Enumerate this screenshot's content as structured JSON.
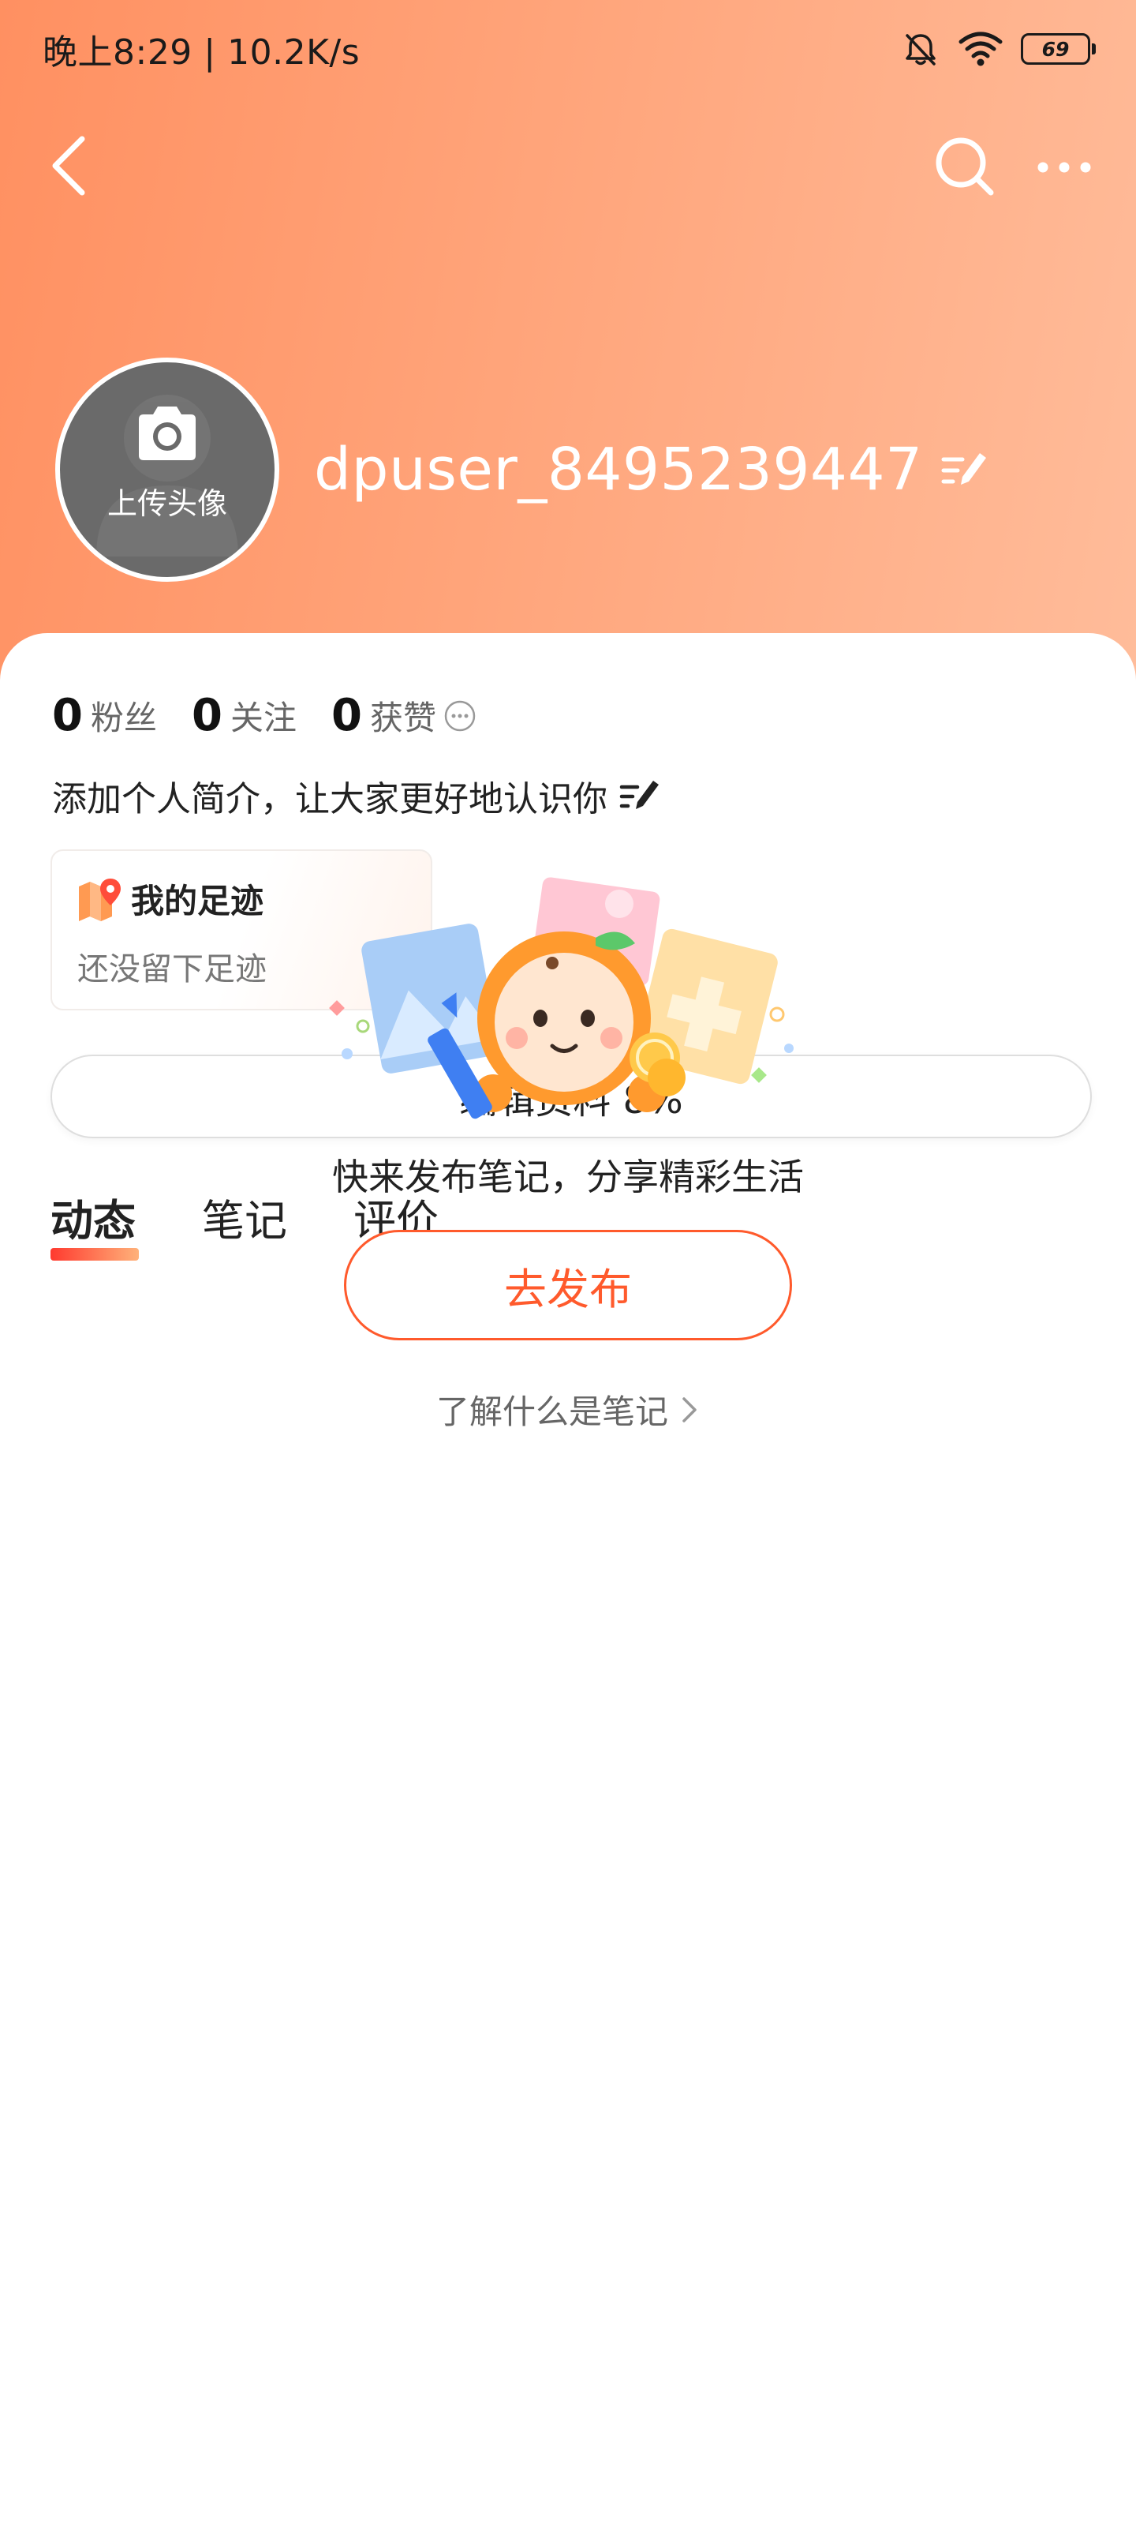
{
  "status_bar": {
    "time_speed": "晚上8:29 | 10.2K/s",
    "battery_level": "69"
  },
  "nav": {
    "back_icon": "chevron-left-icon",
    "search_icon": "search-icon",
    "more_icon": "more-horizontal-icon"
  },
  "profile": {
    "avatar_label": "上传头像",
    "username": "dpuser_8495239447"
  },
  "stats": [
    {
      "value": "0",
      "label": "粉丝"
    },
    {
      "value": "0",
      "label": "关注"
    },
    {
      "value": "0",
      "label": "获赞"
    }
  ],
  "bio": {
    "text": "添加个人简介，让大家更好地认识你"
  },
  "footprint": {
    "title": "我的足迹",
    "subtitle": "还没留下足迹"
  },
  "edit_profile": {
    "label": "编辑资料 8%"
  },
  "tabs": [
    {
      "label": "动态",
      "active": true
    },
    {
      "label": "笔记",
      "active": false
    },
    {
      "label": "评价",
      "active": false
    }
  ],
  "empty_state": {
    "message": "快来发布笔记，分享精彩生活",
    "publish_label": "去发布",
    "learn_label": "了解什么是笔记"
  },
  "colors": {
    "header_gradient_start": "#ff9061",
    "header_gradient_end": "#ffbc9a",
    "accent": "#ff5a2c",
    "tab_underline_start": "#ff3a2f",
    "tab_underline_end": "#ffb27a"
  }
}
